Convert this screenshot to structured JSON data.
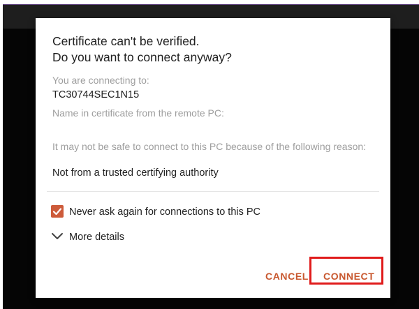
{
  "dialog": {
    "title_line1": "Certificate can't be verified.",
    "title_line2": "Do you want to connect anyway?",
    "connecting_label": "You are connecting to:",
    "connecting_value": "TC30744SEC1N15",
    "cert_name_label": "Name in certificate from the remote PC:",
    "warning_text": "It may not be safe to connect to this PC because of the following reason:",
    "reason": "Not from a trusted certifying authority",
    "checkbox": {
      "label": "Never ask again for connections to this PC",
      "checked": true,
      "icon": "checkmark-icon"
    },
    "more_details": {
      "label": "More details",
      "icon": "chevron-down-icon"
    },
    "buttons": {
      "cancel": "CANCEL",
      "connect": "CONNECT"
    }
  },
  "colors": {
    "accent": "#cd5b3a",
    "button_text": "#c8582f",
    "highlight": "#e01b1b",
    "background": "#050505"
  }
}
